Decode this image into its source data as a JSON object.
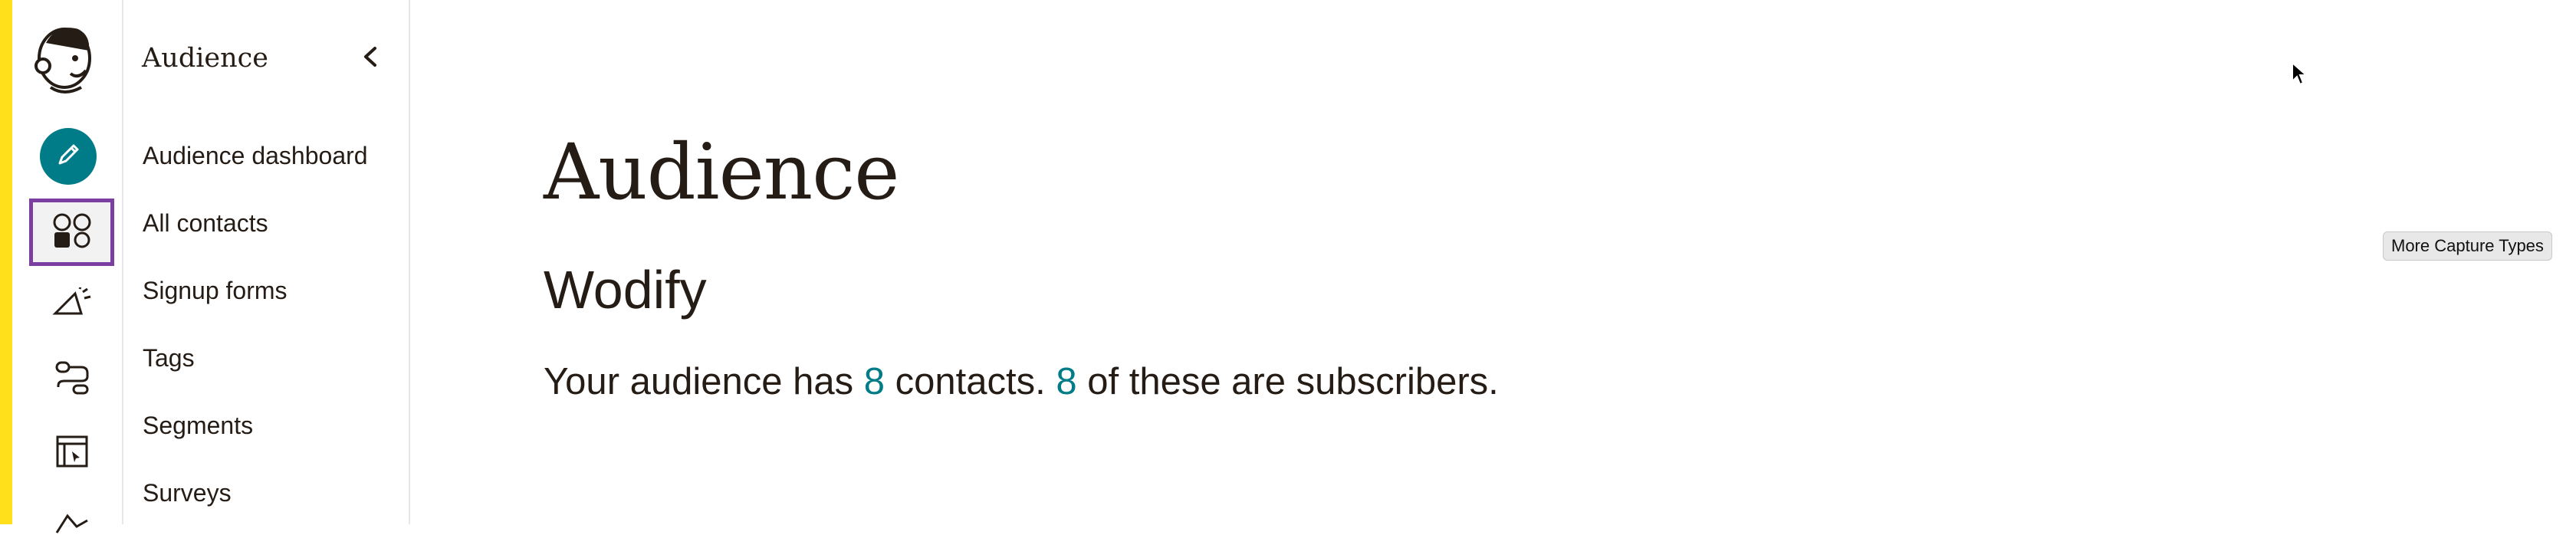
{
  "subnav": {
    "title": "Audience",
    "items": [
      {
        "label": "Audience dashboard"
      },
      {
        "label": "All contacts"
      },
      {
        "label": "Signup forms"
      },
      {
        "label": "Tags"
      },
      {
        "label": "Segments"
      },
      {
        "label": "Surveys"
      }
    ]
  },
  "rail": {
    "icons": [
      "mailchimp-logo-icon",
      "pencil-icon",
      "audience-icon",
      "campaigns-icon",
      "automations-icon",
      "website-icon",
      "content-icon"
    ]
  },
  "main": {
    "title": "Audience",
    "audience_name": "Wodify",
    "summary": {
      "prefix": "Your audience has ",
      "contacts": "8",
      "middle": " contacts. ",
      "subscribers": "8",
      "suffix": " of these are subscribers."
    }
  },
  "overlay": {
    "tooltip": "More Capture Types"
  },
  "colors": {
    "accent": "#007c89",
    "highlight_outline": "#7b3fa1",
    "sidebar_strip": "#ffe01b"
  }
}
